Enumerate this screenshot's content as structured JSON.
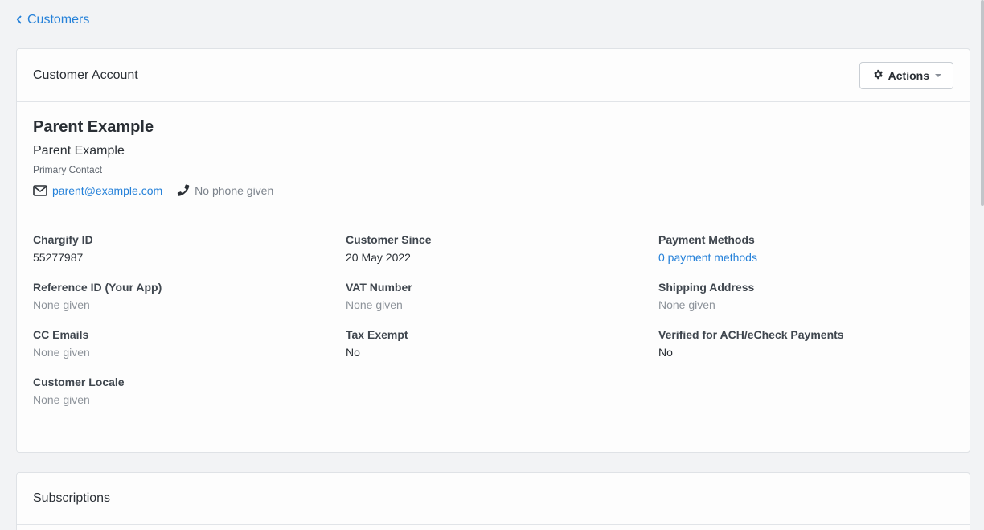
{
  "nav": {
    "back_label": "Customers"
  },
  "account_card": {
    "title": "Customer Account",
    "actions_label": "Actions",
    "customer_name": "Parent Example",
    "contact": {
      "name": "Parent Example",
      "role": "Primary Contact",
      "email": "parent@example.com",
      "phone": "No phone given"
    },
    "fields": [
      {
        "label": "Chargify ID",
        "value": "55277987",
        "style": "normal"
      },
      {
        "label": "Customer Since",
        "value": "20 May 2022",
        "style": "normal"
      },
      {
        "label": "Payment Methods",
        "value": "0 payment methods",
        "style": "link"
      },
      {
        "label": "Reference ID (Your App)",
        "value": "None given",
        "style": "muted"
      },
      {
        "label": "VAT Number",
        "value": "None given",
        "style": "muted"
      },
      {
        "label": "Shipping Address",
        "value": "None given",
        "style": "muted"
      },
      {
        "label": "CC Emails",
        "value": "None given",
        "style": "muted"
      },
      {
        "label": "Tax Exempt",
        "value": "No",
        "style": "normal"
      },
      {
        "label": "Verified for ACH/eCheck Payments",
        "value": "No",
        "style": "normal"
      },
      {
        "label": "Customer Locale",
        "value": "None given",
        "style": "muted"
      }
    ]
  },
  "subscriptions_card": {
    "title": "Subscriptions"
  },
  "icons": {
    "back": "chevron-left-icon",
    "actions": "gear-icon",
    "email": "envelope-icon",
    "phone": "phone-icon"
  },
  "colors": {
    "link": "#2581d9",
    "muted": "#8d939a",
    "background": "#f2f3f5"
  }
}
